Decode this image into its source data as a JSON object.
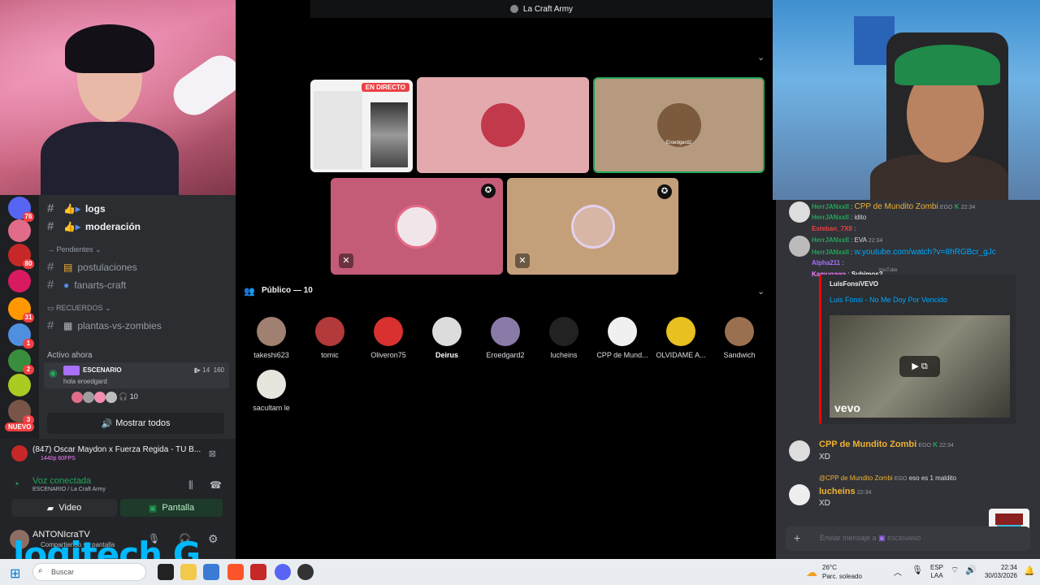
{
  "stage": {
    "header_title": "La Craft Army",
    "live_label": "EN DIRECTO",
    "audience_title": "Público — 10",
    "audience": [
      "takeshi623",
      "tomic",
      "Oliveron75",
      "Deirus",
      "Eroedgard2",
      "lucheins",
      "CPP de Mund...",
      "OLVIDAME A...",
      "Sandwich",
      "sacultam le"
    ],
    "speaker_name_tag": "Eroedgard2"
  },
  "channels": {
    "items": [
      {
        "label": "logs"
      },
      {
        "label": "moderación"
      },
      {
        "label": "postulaciones"
      },
      {
        "label": "fanarts-craft"
      },
      {
        "label": "plantas-vs-zombies"
      }
    ],
    "categories": {
      "pending": "Pendientes",
      "memories": "RECUERDOS"
    },
    "active_now": "Activo ahora",
    "stage_label": "ESCENARIO",
    "stage_sub": "hola eroedgard",
    "stage_cam_count": "14",
    "stage_listeners": "160",
    "mini_count": "10",
    "show_all": "Mostrar todos"
  },
  "servers": {
    "badges": [
      "76",
      "",
      "80",
      "",
      "31",
      "1",
      "2",
      "",
      "3"
    ],
    "new_label": "NUEVO"
  },
  "voice": {
    "now_playing": "(847) Oscar Maydon x Fuerza Regida - TU B...",
    "quality": "1440p 60FPS",
    "connected": "Voz conectada",
    "channel": "ESCENARIO / La Craft Army",
    "video_btn": "Video",
    "screen_btn": "Pantalla",
    "user_name": "ANTONIcraTV",
    "user_status": "Compartiendo su pantalla",
    "brand": "logitech G"
  },
  "chat": {
    "lines": [
      {
        "user": "HerrJANxxII",
        "text": "CPP de Mundito Zombi",
        "color": "#23a55a"
      },
      {
        "user": "HerrJANxxII",
        "text": "idito",
        "color": "#23a55a"
      },
      {
        "user": "Esteban_7X8",
        "text": "",
        "color": "#f23f42"
      },
      {
        "user": "HerrJANxxII",
        "text": "EVA",
        "color": "#23a55a"
      },
      {
        "user": "HerrJANxxII",
        "text": "w.youtube.com/watch?v=8hRGBcr_gJc",
        "color": "#23a55a"
      },
      {
        "user": "Alpha211",
        "text": "",
        "color": "#a970ff"
      },
      {
        "user": "Kamugawa",
        "text": "Subimos?",
        "color": "#f47fff"
      }
    ],
    "top_badge": "EGO",
    "top_time": "22:34",
    "top_time2": "22:34",
    "embed_provider": "YouTube",
    "embed_author": "LuisFonsiVEVO",
    "embed_title": "Luis Fonsi - No Me Doy Por Vencido",
    "embed_logo": "vevo",
    "messages": [
      {
        "user": "CPP de Mundito Zombi",
        "badge": "EGO",
        "time": "22:34",
        "text": "XD",
        "color": "#f0b132"
      },
      {
        "user": "lucheins",
        "time": "22:34",
        "text": "XD",
        "color": "#f0b132",
        "reply_to": "@CPP de Mundito Zombi",
        "reply_badge": "EGO",
        "reply_text": "eso es 1 maldito"
      }
    ],
    "input_placeholder": "Enviar mensaje a",
    "input_channel": "ESCENARIO"
  },
  "taskbar": {
    "search_placeholder": "Buscar",
    "temp": "26°C",
    "weather": "Parc. soleado",
    "lang1": "ESP",
    "lang2": "LAA",
    "time": "22:34",
    "date": "30/03/2026"
  },
  "colors": {
    "accent_green": "#23a55a",
    "live_red": "#ed4245",
    "link_blue": "#00a8fc",
    "logitech_blue": "#00b8fc"
  }
}
